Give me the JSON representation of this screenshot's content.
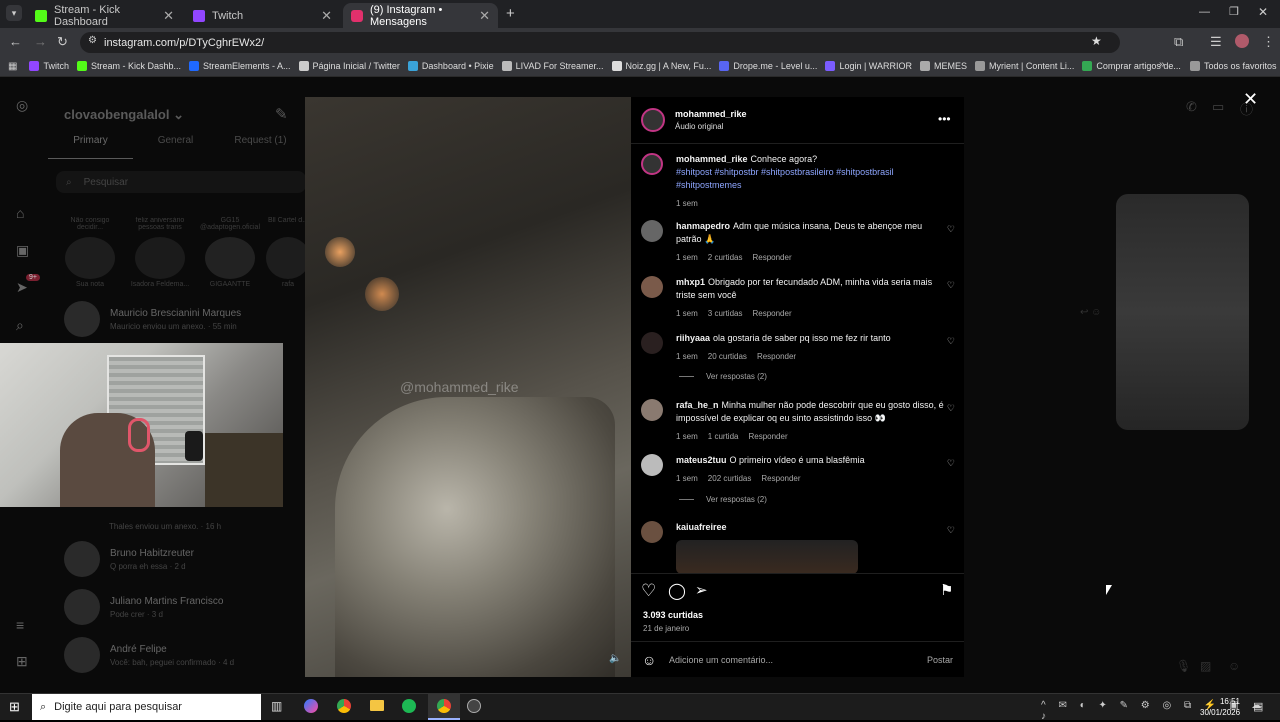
{
  "browser": {
    "tabs": [
      {
        "title": "Stream - Kick Dashboard",
        "color": "#53fc18",
        "active": false
      },
      {
        "title": "Twitch",
        "color": "#9146ff",
        "active": false
      },
      {
        "title": "(9) Instagram • Mensagens",
        "color": "#e1306c",
        "active": true
      }
    ],
    "url": "instagram.com/p/DTyCghrEWx2/",
    "bookmarks": [
      {
        "label": "Twitch",
        "color": "#9146ff"
      },
      {
        "label": "Stream - Kick Dashb...",
        "color": "#53fc18"
      },
      {
        "label": "StreamElements - A...",
        "color": "#1f69ff"
      },
      {
        "label": "Página Inicial / Twitter",
        "color": "#cccccc"
      },
      {
        "label": "Dashboard • Pixie",
        "color": "#3aa3d9"
      },
      {
        "label": "LIVAD For Streamer...",
        "color": "#bbbbbb"
      },
      {
        "label": "Noiz.gg | A New, Fu...",
        "color": "#dddddd"
      },
      {
        "label": "Drope.me - Level u...",
        "color": "#5865f2"
      },
      {
        "label": "Login | WARRIOR",
        "color": "#7b5cff"
      },
      {
        "label": "MEMES",
        "color": "#aaaaaa"
      },
      {
        "label": "Myrient | Content Li...",
        "color": "#999999"
      },
      {
        "label": "Comprar artigos de...",
        "color": "#34a853"
      }
    ],
    "all_favorites": "Todos os favoritos"
  },
  "dm": {
    "account": "clovaobengalalol",
    "tabs": [
      "Primary",
      "General",
      "Request (1)"
    ],
    "search_placeholder": "Pesquisar",
    "notes": [
      {
        "note": "Não consigo decidir...",
        "name": "Sua nota"
      },
      {
        "note": "feliz aniversário pessoas trans",
        "name": "Isadora Feldema..."
      },
      {
        "note": "GG15 @adaptogen.oficial",
        "name": "GIGAANTTE"
      },
      {
        "note": "Bll Cartel d...",
        "name": "rafa"
      }
    ],
    "conversations": [
      {
        "name": "Mauricio Brescianini Marques",
        "sub": "Mauricio enviou um anexo. · 55 min"
      },
      {
        "name": "",
        "sub": "Thales enviou um anexo. · 16 h"
      },
      {
        "name": "Bruno Habitzreuter",
        "sub": "Q porra eh essa · 2 d"
      },
      {
        "name": "Juliano Martins Francisco",
        "sub": "Pode crer · 3 d"
      },
      {
        "name": "André Felipe",
        "sub": "Você: bah, peguei confirmado · 4 d"
      }
    ],
    "badge": "9+"
  },
  "post": {
    "author": "mohammed_rike",
    "audio": "Áudio original",
    "watermark": "@mohammed_rike",
    "caption": {
      "user": "mohammed_rike",
      "text": "Conhece agora?",
      "tags": "#shitpost #shitpostbr #shitpostbrasileiro #shitpostbrasil #shitpostmemes",
      "time": "1 sem"
    },
    "comments": [
      {
        "user": "hanmapedro",
        "text": "Adm que música insana, Deus te abençoe meu patrão 🙏",
        "time": "1 sem",
        "likes": "2 curtidas",
        "reply": "Responder"
      },
      {
        "user": "mhxp1",
        "text": "Obrigado por ter fecundado ADM, minha vida seria mais triste sem você",
        "time": "1 sem",
        "likes": "3 curtidas",
        "reply": "Responder"
      },
      {
        "user": "riihyaaa",
        "text": "ola gostaria de saber pq isso me fez rir tanto",
        "time": "1 sem",
        "likes": "20 curtidas",
        "reply": "Responder",
        "replies": "Ver respostas (2)"
      },
      {
        "user": "rafa_he_n",
        "text": "Minha mulher não pode descobrir que eu gosto disso, é impossível de explicar oq eu sinto assistindo isso 👀",
        "time": "1 sem",
        "likes": "1 curtida",
        "reply": "Responder"
      },
      {
        "user": "mateus2tuu",
        "text": "O primeiro vídeo é uma blasfêmia",
        "time": "1 sem",
        "likes": "202 curtidas",
        "reply": "Responder",
        "replies": "Ver respostas (2)"
      },
      {
        "user": "kaiuafreiree",
        "text": "",
        "time": "",
        "likes": "",
        "reply": ""
      }
    ],
    "likes_total": "3.093 curtidas",
    "date": "21 de janeiro",
    "comment_placeholder": "Adicione um comentário...",
    "post_button": "Postar"
  },
  "taskbar": {
    "search": "Digite aqui para pesquisar",
    "time": "16:51",
    "date": "30/01/2026"
  }
}
